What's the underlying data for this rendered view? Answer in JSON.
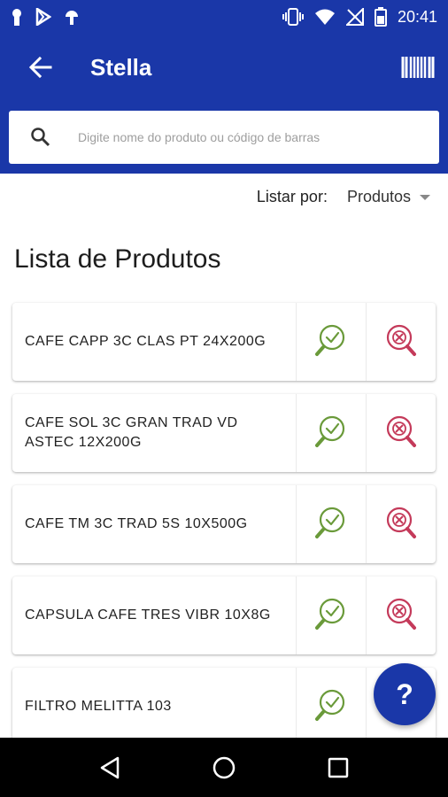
{
  "status": {
    "time": "20:41"
  },
  "appbar": {
    "title": "Stella"
  },
  "search": {
    "placeholder": "Digite nome do produto ou código de barras"
  },
  "listby": {
    "label": "Listar por:",
    "selected": "Produtos"
  },
  "heading": "Lista de Produtos",
  "products": [
    {
      "name": "CAFE CAPP 3C CLAS PT 24X200G"
    },
    {
      "name": "CAFE SOL 3C GRAN TRAD VD ASTEC 12X200G"
    },
    {
      "name": "CAFE TM 3C TRAD 5S 10X500G"
    },
    {
      "name": "CAPSULA CAFE TRES VIBR 10X8G"
    },
    {
      "name": "FILTRO MELITTA 103"
    }
  ],
  "fab": {
    "label": "?"
  },
  "colors": {
    "primary": "#1a37a8",
    "check": "#6a9a3a",
    "remove": "#c43a5a"
  }
}
